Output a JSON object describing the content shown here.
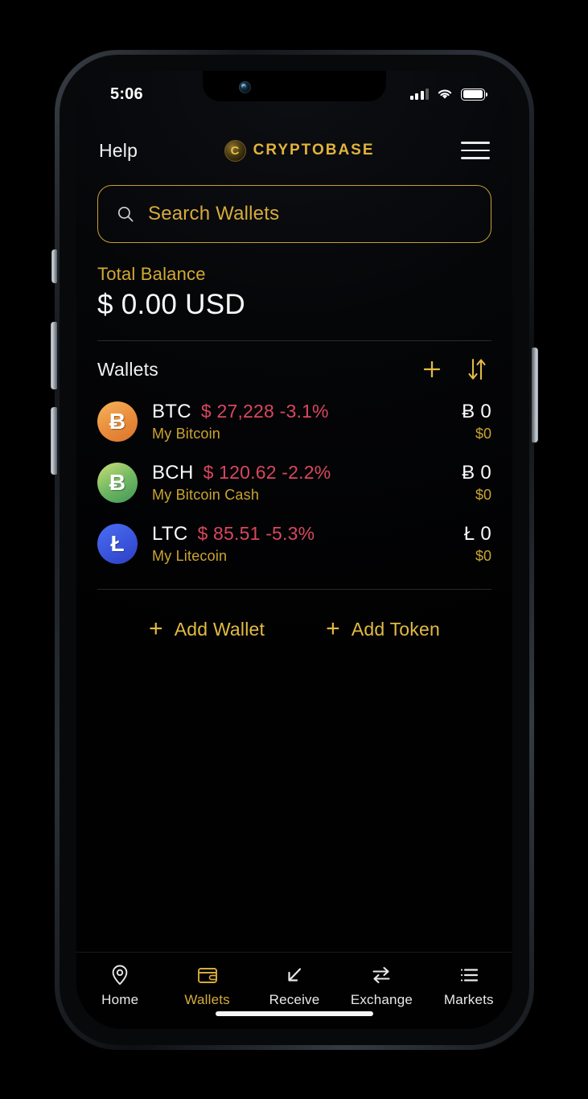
{
  "status_bar": {
    "time": "5:06",
    "signal_icon": "cellular-signal-icon",
    "wifi_icon": "wifi-icon",
    "battery_icon": "battery-full-icon"
  },
  "header": {
    "help_label": "Help",
    "brand_mark": "C",
    "brand_name": "CRYPTOBASE",
    "menu_icon": "hamburger-menu-icon"
  },
  "search": {
    "placeholder": "Search Wallets",
    "icon": "search-icon"
  },
  "balance": {
    "label": "Total Balance",
    "value": "$ 0.00 USD"
  },
  "wallets_section": {
    "title": "Wallets",
    "add_icon": "plus-icon",
    "sort_icon": "sort-arrows-icon",
    "rows": [
      {
        "symbol": "BTC",
        "price": "$ 27,228 -3.1%",
        "name": "My Bitcoin",
        "amount": "Ƀ 0",
        "fiat": "$0",
        "glyph": "Ƀ",
        "icon": "bitcoin-icon"
      },
      {
        "symbol": "BCH",
        "price": "$ 120.62 -2.2%",
        "name": "My Bitcoin Cash",
        "amount": "Ƀ 0",
        "fiat": "$0",
        "glyph": "Ƀ",
        "icon": "bitcoin-cash-icon"
      },
      {
        "symbol": "LTC",
        "price": "$ 85.51 -5.3%",
        "name": "My Litecoin",
        "amount": "Ł 0",
        "fiat": "$0",
        "glyph": "Ł",
        "icon": "litecoin-icon"
      }
    ]
  },
  "actions": {
    "add_wallet": "Add Wallet",
    "add_token": "Add Token",
    "plus_glyph": "+"
  },
  "tabbar": {
    "items": [
      {
        "label": "Home",
        "icon": "location-pin-icon",
        "active": false
      },
      {
        "label": "Wallets",
        "icon": "wallet-icon",
        "active": true
      },
      {
        "label": "Receive",
        "icon": "arrow-down-left-icon",
        "active": false
      },
      {
        "label": "Exchange",
        "icon": "swap-arrows-icon",
        "active": false
      },
      {
        "label": "Markets",
        "icon": "list-icon",
        "active": false
      }
    ]
  },
  "colors": {
    "gold": "#d6ab3a",
    "gold_bright": "#e2bb42",
    "negative_red": "#d8475e",
    "text_white": "#fafafa",
    "background": "#020203"
  }
}
